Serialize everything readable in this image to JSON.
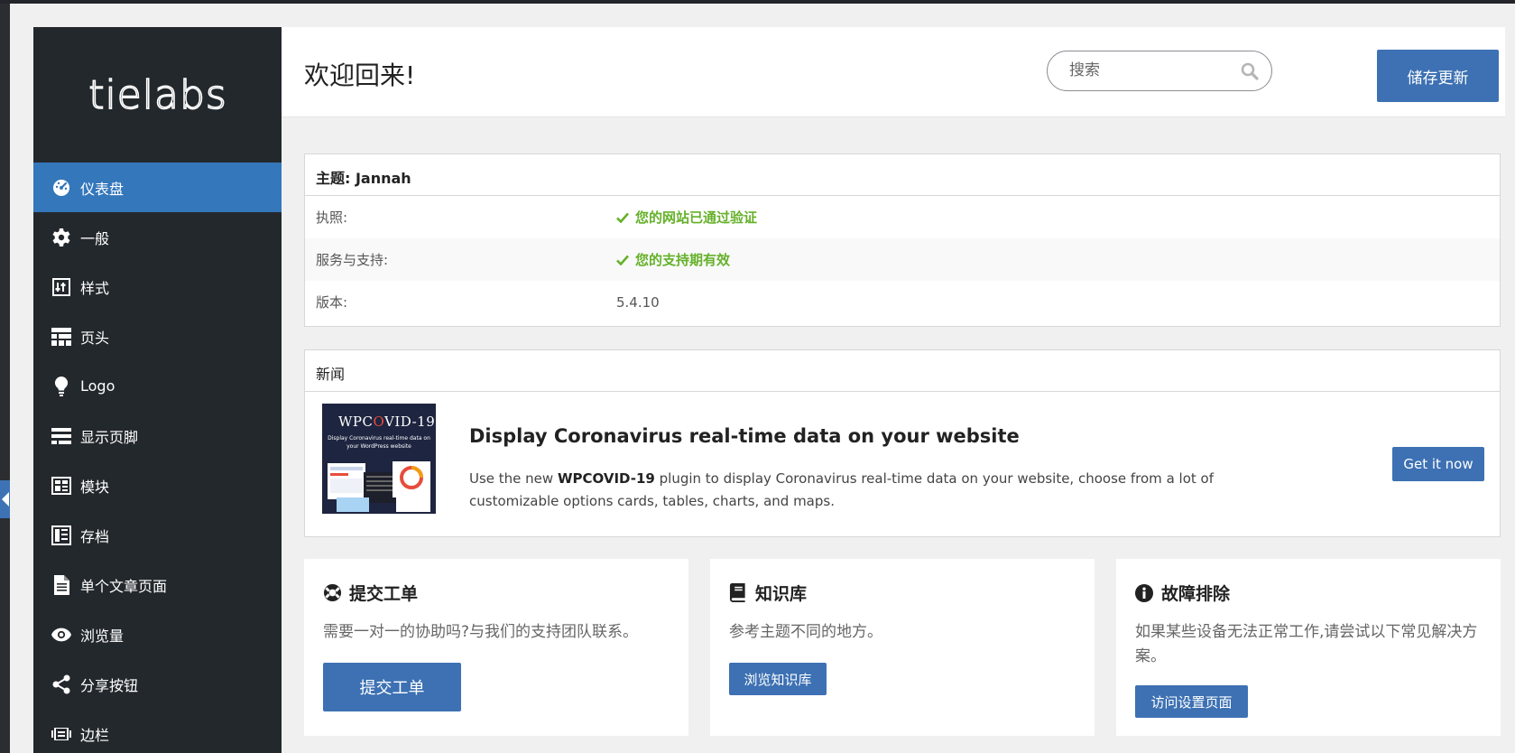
{
  "colors": {
    "sidebar_bg": "#23282d",
    "active_item": "#3477bb",
    "primary_button": "#3d71b3",
    "success": "#65b12a"
  },
  "brand": {
    "logo_text": "tielabs"
  },
  "sidebar": {
    "items": [
      {
        "label": "仪表盘",
        "icon": "dashboard-icon",
        "active": true
      },
      {
        "label": "一般",
        "icon": "gear-icon"
      },
      {
        "label": "样式",
        "icon": "sliders-icon"
      },
      {
        "label": "页头",
        "icon": "header-layout-icon"
      },
      {
        "label": "Logo",
        "icon": "lightbulb-icon"
      },
      {
        "label": "显示页脚",
        "icon": "footer-layout-icon"
      },
      {
        "label": "模块",
        "icon": "blocks-icon"
      },
      {
        "label": "存档",
        "icon": "archive-icon"
      },
      {
        "label": "单个文章页面",
        "icon": "document-icon"
      },
      {
        "label": "浏览量",
        "icon": "eye-icon"
      },
      {
        "label": "分享按钮",
        "icon": "share-icon"
      },
      {
        "label": "边栏",
        "icon": "sidebar-icon"
      }
    ]
  },
  "header": {
    "title": "欢迎回来!",
    "search_placeholder": "搜索",
    "save_label": "储存更新"
  },
  "theme_info": {
    "title": "主题: Jannah",
    "rows": [
      {
        "label": "执照:",
        "value": "您的网站已通过验证",
        "status": "ok"
      },
      {
        "label": "服务与支持:",
        "value": "您的支持期有效",
        "status": "ok"
      },
      {
        "label": "版本:",
        "value": "5.4.10",
        "status": "plain"
      }
    ]
  },
  "news": {
    "heading": "新闻",
    "thumb_brand_prefix": "WPC",
    "thumb_brand_o": "O",
    "thumb_brand_suffix": "VID-19",
    "thumb_caption": "Display Coronavirus real-time data on your WordPress website",
    "title": "Display Coronavirus real-time data on your website",
    "desc_prefix": "Use the new ",
    "desc_bold": "WPCOVID-19",
    "desc_suffix": " plugin to display Coronavirus real-time data on your website, choose from a lot of customizable options cards, tables, charts, and maps.",
    "button_label": "Get it now"
  },
  "cards": [
    {
      "title": "提交工单",
      "icon": "lifebuoy-icon",
      "text": "需要一对一的协助吗?与我们的支持团队联系。",
      "button": "提交工单"
    },
    {
      "title": "知识库",
      "icon": "book-icon",
      "text": "参考主题不同的地方。",
      "button": "浏览知识库"
    },
    {
      "title": "故障排除",
      "icon": "info-icon",
      "text": "如果某些设备无法正常工作,请尝试以下常见解决方案。",
      "button": "访问设置页面"
    }
  ]
}
